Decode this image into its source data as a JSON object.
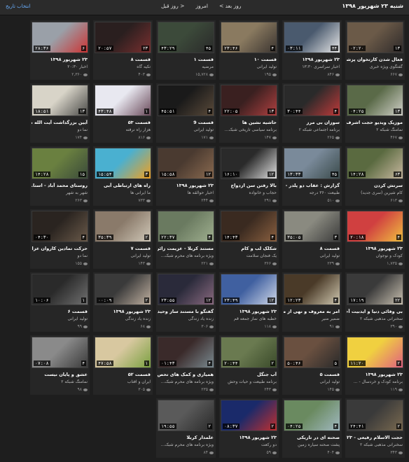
{
  "header": {
    "date": "شنبه ۲۳ شهریور ۱۳۹۸",
    "next_day": "روز بعد >",
    "today": "امروز",
    "prev_day": "< روز قبل",
    "pick_date": "انتخاب تاریخ"
  },
  "cards": [
    {
      "title": "فعال شدن کارتخوان پزشکا...",
      "sub": "گفتگوی ویژه خبری",
      "views": "۶۶۷",
      "dur": "۰۲:۲۰",
      "count": "۱۳",
      "c1": "#6b5a48",
      "c2": "#2e2a2a"
    },
    {
      "title": "۲۳ شهریور ۱۳۹۸",
      "sub": "اخبار سراسری ۱۳:۳۰",
      "views": "۸۴۶",
      "dur": "۰۳:۱۱",
      "count": "۴۴",
      "c1": "#4a5a6e",
      "c2": "#e8e8e8"
    },
    {
      "title": "قسمت ۱۰",
      "sub": "تولید ایرانی",
      "views": "۱۹۵",
      "dur": "۲۳:۴۶",
      "count": "۴",
      "c1": "#8a7a60",
      "c2": "#3a3430"
    },
    {
      "title": "قسمت ۱",
      "sub": "مرضیه",
      "views": "۱۵,۷۲۸",
      "dur": "۴۳:۲۹",
      "count": "۴۵",
      "c1": "#3c4a3a",
      "c2": "#2a2a2a"
    },
    {
      "title": "قسمت ۸",
      "sub": "تکیه گاه",
      "views": "۴۰۳",
      "dur": "۲۰:۵۷",
      "count": "۲۳",
      "c1": "#2a1f1f",
      "c2": "#7a3030"
    },
    {
      "title": "۲۳ شهریور ۱۳۹۸",
      "sub": "اخبار ۲۰:۳۰",
      "views": "۲,۳۶۰",
      "dur": "۲۸:۳۶",
      "count": "۶",
      "c1": "#9aa0a8",
      "c2": "#cc3333"
    },
    {
      "title": "موزیک ویدیو حجت اشرف...",
      "sub": "نمامنگ شبکه ۲",
      "views": "۴۶۷",
      "dur": "۰۴:۲۵",
      "count": "۱۳",
      "c1": "#5a6a48",
      "c2": "#d0d0c8"
    },
    {
      "title": "سوزان بی مرز",
      "sub": "برنامه اجتماعی شبکه ۲",
      "views": "۲۶۵",
      "dur": "۳۰:۴۴",
      "count": "۴",
      "c1": "#2a2a2a",
      "c2": "#c03a3a"
    },
    {
      "title": "حاشیه نشین ها",
      "sub": "برنامه سیاسی تاریخی شبک...",
      "views": "۱۴۷",
      "dur": "۲۲:۰۵",
      "count": "۱۳",
      "c1": "#3a2020",
      "c2": "#b04040"
    },
    {
      "title": "قسمت 9",
      "sub": "تولید ایرانی",
      "views": "۱۷۱",
      "dur": "۴۵:۵۱",
      "count": "۴",
      "c1": "#1a1a1a",
      "c2": "#5a4a3a"
    },
    {
      "title": "قسمت ۵۳",
      "sub": "هزار راه نرفته",
      "views": "۸۱۶",
      "dur": "۴۳:۴۸",
      "count": "۱",
      "c1": "#e8e8f0",
      "c2": "#6a4a5a"
    },
    {
      "title": "آیین بزرگداشت آیت الله ط...",
      "sub": "نما دو",
      "views": "۱۷۴",
      "dur": "۱۸:۵۱",
      "count": "۱۳",
      "c1": "#d8d4c8",
      "c2": "#4a4a48"
    },
    {
      "title": "سرتش کردن",
      "sub": "کام شیرین (سری جدید)",
      "views": "۶۱۳",
      "dur": "۱۴:۲۸",
      "count": "۶۳",
      "c1": "#5a6a40",
      "c2": "#c8b8a0"
    },
    {
      "title": "گزارش : عقاب دو پلدر - ڤ...",
      "sub": "طبیعت ۳۶۰ درجه",
      "views": "۵۱۰",
      "dur": "۱۳:۳۳",
      "count": "۴۵",
      "c1": "#7a8a9a",
      "c2": "#3a4a4a"
    },
    {
      "title": "بالا رفتن سن ازدواج",
      "sub": "حجاب و خانواده",
      "views": "۲۹۱",
      "dur": "۱۶:۱۰",
      "count": "۱۲",
      "c1": "#2a2a2a",
      "c2": "#e0e0e0"
    },
    {
      "title": "۲۳ شهریور ۱۳۹۸",
      "sub": "اخبار حوالقه ها",
      "views": "۲۴۴",
      "dur": "۱۵:۵۸",
      "count": "۱۲",
      "c1": "#4a3a30",
      "c2": "#8a6a50"
    },
    {
      "title": "راه های ارتباطی آبی",
      "sub": "ما ایرانی ها",
      "views": "۷۳۳",
      "dur": "۱۵:۵۴",
      "count": "۳",
      "c1": "#4ab0d0",
      "c2": "#f0a020"
    },
    {
      "title": "روستای محمد آباد - استا...",
      "sub": "شهر به شهر",
      "views": "۲۶۳",
      "dur": "۱۴:۲۸",
      "count": "۱۵",
      "c1": "#6a8040",
      "c2": "#3a4a3a"
    },
    {
      "title": "۲۳ شهریور ۱۳۹۸",
      "sub": "کودک و نوجوان",
      "views": "۱,۷۳۵",
      "dur": "۲۰:۱۸",
      "count": "۴",
      "c1": "#d04040",
      "c2": "#f0c040"
    },
    {
      "title": "قسمت ۸",
      "sub": "تولید ایرانی",
      "views": "۲۳۹",
      "dur": "۳۵:۰۵",
      "count": "۳",
      "c1": "#8a8a80",
      "c2": "#3a3a3a"
    },
    {
      "title": "شکلک لب و کام",
      "sub": "یک فنجان سلامت",
      "views": "۳۶۶",
      "dur": "۱۴:۴۳",
      "count": "۴",
      "c1": "#3a2a20",
      "c2": "#8a6040"
    },
    {
      "title": "مستند کربلا - عزیمت زائرا...",
      "sub": "ویژه برنامه های محرم شبک...",
      "views": "۲۲۱",
      "dur": "۲۲:۳۷",
      "count": "۴",
      "c1": "#6a7a60",
      "c2": "#a0b090"
    },
    {
      "title": "قسمت ۷",
      "sub": "تولید ایرانی",
      "views": "۱۴۳",
      "dur": "۳۵:۳۹",
      "count": "۲",
      "c1": "#8a7a6a",
      "c2": "#d0c8b8"
    },
    {
      "title": "حرکت تمادین کاروان عزاد...",
      "sub": "نما دو",
      "views": "۱۵۵",
      "dur": "۰۴:۳۰",
      "count": "۴",
      "c1": "#2a2420",
      "c2": "#6a5a4a"
    },
    {
      "title": "بی وفائی دنیا و ایدبیت آخرت",
      "sub": "سخنرانی مذهبی شبکه ۲",
      "views": "۳۹۰",
      "dur": "۱۷:۱۹",
      "count": "۲۲",
      "c1": "#3a3a3a",
      "c2": "#c8c0b0"
    },
    {
      "title": "امر به معروف و نهی از منکر",
      "sub": "ضمیر منیر",
      "views": "۹۱",
      "dur": "۱۲:۲۳",
      "count": "۴",
      "c1": "#4a3a28",
      "c2": "#d0c8b0"
    },
    {
      "title": "۲۳ شهریور ۱۳۹۸",
      "sub": "خطبه های نماز جمعه قم",
      "views": "۱۱۸",
      "dur": "۲۳:۴۹",
      "count": "۱۲",
      "c1": "#4060a0",
      "c2": "#d0d8e8"
    },
    {
      "title": "گفتگو با مستند ساز وحید ...",
      "sub": "زنده یاد زندگی",
      "views": "۳۰۶",
      "dur": "۲۳:۵۵",
      "count": "۱۲",
      "c1": "#2a2a3a",
      "c2": "#8a6a80"
    },
    {
      "title": "۲۳ شهریور ۱۳۹۸",
      "sub": "زنده یاد زندگی",
      "views": "۶۸",
      "dur": "۰۰:۰۹",
      "count": "۲",
      "c1": "#3a3a3a",
      "c2": "#c0b0a0"
    },
    {
      "title": "قسمت ۶",
      "sub": "تولید ایرانی",
      "views": "۹۹",
      "dur": "۱۰:۰۶",
      "count": "۱",
      "c1": "#2a2a2a",
      "c2": "#707070"
    },
    {
      "title": "۲۳ شهریور ۱۳۹۸",
      "sub": "برنامه کودک و خردسال - ...",
      "views": "۱۱۹",
      "dur": "۱۱:۲۰",
      "count": "۲",
      "c1": "#f0d040",
      "c2": "#e06080"
    },
    {
      "title": "قسمت ۵",
      "sub": "تولید ایرانی",
      "views": "۱۴۵",
      "dur": "۵۰:۴۶",
      "count": "۵",
      "c1": "#6a5040",
      "c2": "#2a2a2a"
    },
    {
      "title": "آب جنگل",
      "sub": "برنامه طبیعت و حیات وحش",
      "views": "۲۴۳",
      "dur": "۲۰:۴۴",
      "count": "۲",
      "c1": "#6a7a50",
      "c2": "#3a4a2a"
    },
    {
      "title": "همیاری و کمک های تحص...",
      "sub": "ویژه برنامه های محرم شبک...",
      "views": "۲۳۵",
      "dur": "۰۱:۴۳",
      "count": "۴",
      "c1": "#3a2a2a",
      "c2": "#7a8a90"
    },
    {
      "title": "قسمت ۵۲",
      "sub": "ایران و آفتاب",
      "views": "۳۰۵",
      "dur": "۴۷:۵۸",
      "count": "۱",
      "c1": "#d8c8a0",
      "c2": "#7aa040"
    },
    {
      "title": "عشق و پایان نیست",
      "sub": "نمامنگ شبکه ۲",
      "views": "۹۸",
      "dur": "۰۷:۰۸",
      "count": "۴",
      "c1": "#8a8a8a",
      "c2": "#3a3a3a"
    },
    {
      "title": "حجت الاسلام رفیعی - ۲۳...",
      "sub": "سخنرانی مذهبی شبکه ۲",
      "views": "۳۴۳",
      "dur": "۲۴:۴۱",
      "count": "۲",
      "c1": "#3a3a3a",
      "c2": "#7a6a50"
    },
    {
      "title": "صحنه ای در تاریکی",
      "sub": "پشت صحنه سیاره زمین",
      "views": "۴۰۴",
      "dur": "۰۴:۲۵",
      "count": "۴",
      "c1": "#6a8a60",
      "c2": "#a0b8c0"
    },
    {
      "title": "۲۳ شهریور ۱۳۹۸",
      "sub": "دو رکعت",
      "views": "۵۹",
      "dur": "۰۸:۳۷",
      "count": "۲",
      "c1": "#1a2a6a",
      "c2": "#c03030"
    },
    {
      "title": "علمدار کربلا",
      "sub": "ویژه برنامه های محرم شبک...",
      "views": "۸۴",
      "dur": "۱۹:۵۵",
      "count": "۲",
      "c1": "#5a5a5a",
      "c2": "#2a2a2a"
    }
  ]
}
